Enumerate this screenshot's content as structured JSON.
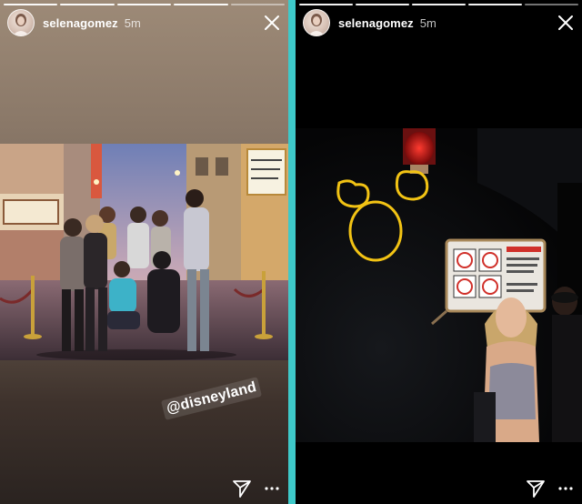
{
  "stories": [
    {
      "username": "selenagomez",
      "timestamp": "5m",
      "sticker_text": "@disneyland",
      "progress_segments": 5,
      "progress_completed": 4
    },
    {
      "username": "selenagomez",
      "timestamp": "5m",
      "progress_segments": 5,
      "progress_completed": 4
    }
  ],
  "colors": {
    "divider": "#3ec9c9",
    "doodle_yellow": "#f2c314"
  },
  "icons": [
    "avatar",
    "close-icon",
    "send-icon",
    "more-icon"
  ]
}
